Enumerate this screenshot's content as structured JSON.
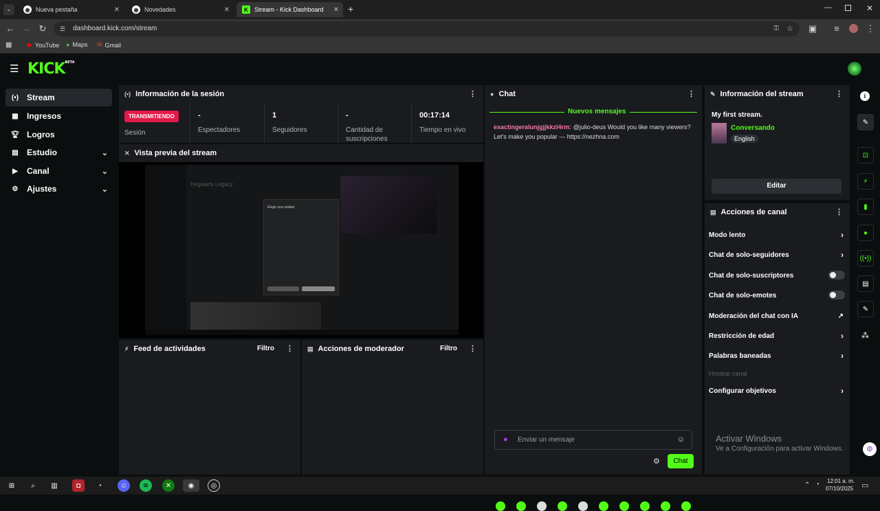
{
  "browser": {
    "tabs": [
      {
        "label": "Nueva pestaña"
      },
      {
        "label": "Novedades"
      },
      {
        "label": "Stream - Kick Dashboard"
      }
    ],
    "url": "dashboard.kick.com/stream",
    "bookmarks": [
      "YouTube",
      "Maps",
      "Gmail"
    ]
  },
  "app": {
    "logo": "KICK",
    "logo_sup": "BETA",
    "brand_color": "#53fc18"
  },
  "sidebar": {
    "items": [
      {
        "label": "Stream",
        "icon": "stream-icon"
      },
      {
        "label": "Ingresos",
        "icon": "revenue-icon"
      },
      {
        "label": "Logros",
        "icon": "trophy-icon"
      },
      {
        "label": "Estudio",
        "icon": "studio-icon"
      },
      {
        "label": "Canal",
        "icon": "channel-icon"
      },
      {
        "label": "Ajustes",
        "icon": "gear-icon"
      }
    ]
  },
  "session": {
    "title": "Información de la sesión",
    "badge": "TRANSMITIENDO",
    "badge_color": "#e01b4a",
    "session_label": "Sesión",
    "stats": [
      {
        "value": "-",
        "label": "Espectadores"
      },
      {
        "value": "1",
        "label": "Seguidores"
      },
      {
        "value": "-",
        "label": "Cantidad de suscripciones"
      },
      {
        "value": "00:17:14",
        "label": "Tiempo en vivo"
      }
    ]
  },
  "preview": {
    "title": "Vista previa del stream",
    "game_title": "Hogwarts Legacy",
    "dialog_title": "Elegir una unidad"
  },
  "feed": {
    "title": "Feed de actividades",
    "filter": "Filtro"
  },
  "moderator": {
    "title": "Acciones de moderador",
    "filter": "Filtro"
  },
  "chat": {
    "title": "Chat",
    "new_messages": "Nuevos mensajes",
    "messages": [
      {
        "user": "exactingeralunjgjjkkzl4rm:",
        "text": "@julio-deus Would you like many viewers? Let's make you popular — https://nezhna.com"
      }
    ],
    "input_placeholder": "Enviar un mensaje",
    "send_label": "Chat"
  },
  "stream_info": {
    "title": "Información del stream",
    "stream_title": "My first stream.",
    "category": "Conversando",
    "language": "English",
    "edit_label": "Editar"
  },
  "channel_actions": {
    "title": "Acciones de canal",
    "items": [
      {
        "label": "Modo lento",
        "control": "arrow"
      },
      {
        "label": "Chat de solo-seguidores",
        "control": "arrow"
      },
      {
        "label": "Chat de solo-suscriptores",
        "control": "toggle"
      },
      {
        "label": "Chat de solo-emotes",
        "control": "toggle"
      },
      {
        "label": "Moderación del chat con IA",
        "control": "external"
      },
      {
        "label": "Restricción de edad",
        "control": "arrow"
      },
      {
        "label": "Palabras baneadas",
        "control": "arrow"
      },
      {
        "label": "Hostear canal",
        "control": "disabled"
      },
      {
        "label": "Configurar objetivos",
        "control": "arrow"
      }
    ]
  },
  "windows": {
    "activate_title": "Activar Windows",
    "activate_sub": "Ve a Configuración para activar Windows.",
    "time": "12:01 a. m.",
    "date": "07/10/2025"
  }
}
